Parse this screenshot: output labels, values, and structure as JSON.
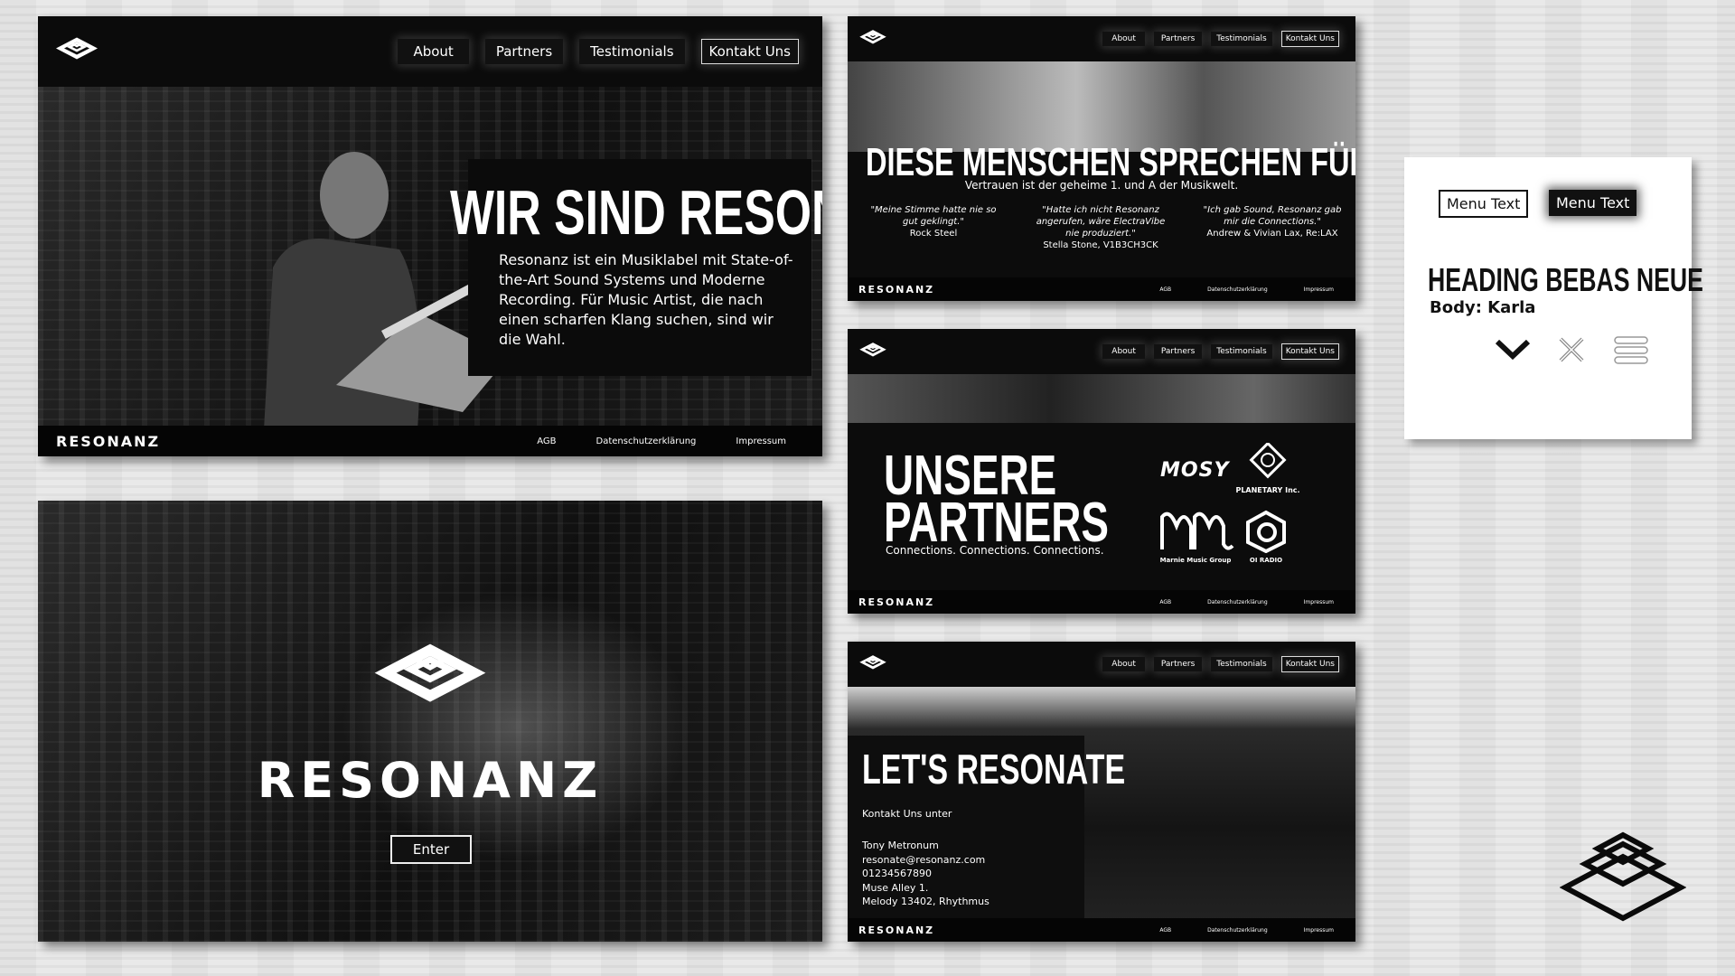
{
  "nav": {
    "about": "About",
    "partners": "Partners",
    "testimonials": "Testimonials",
    "contact": "Kontakt Uns"
  },
  "footer": {
    "brand": "RESONANZ",
    "agb": "AGB",
    "privacy": "Datenschutzerklärung",
    "imprint": "Impressum"
  },
  "home": {
    "heading": "WIR SIND RESONANZ",
    "body": "Resonanz ist ein Musiklabel mit State-of-the-Art Sound Systems und Moderne Recording. Für Music Artist, die nach einen scharfen Klang suchen, sind wir die Wahl."
  },
  "landing": {
    "brand": "RESONANZ",
    "enter": "Enter"
  },
  "testimonials": {
    "heading": "DIESE MENSCHEN SPRECHEN FÜR UNS",
    "subheading": "Vertrauen ist der geheime 1. und A der Musikwelt.",
    "items": [
      {
        "quote": "\"Meine Stimme hatte nie so gut geklingt.\"",
        "author": "Rock Steel"
      },
      {
        "quote": "\"Hatte ich nicht Resonanz angerufen, wäre ElectraVibe nie produziert.\"",
        "author": "Stella Stone, V1B3CH3CK"
      },
      {
        "quote": "\"Ich gab Sound, Resonanz gab mir die Connections.\"",
        "author": "Andrew & Vivian Lax, Re:LAX"
      }
    ]
  },
  "partners": {
    "heading_line1": "UNSERE",
    "heading_line2": "PARTNERS",
    "tagline": "Connections. Connections. Connections.",
    "logos": [
      {
        "name": "MOSY",
        "label": ""
      },
      {
        "name": "planetary",
        "label": "PLANETARY Inc."
      },
      {
        "name": "MM",
        "label": "Marnie Music Group"
      },
      {
        "name": "oi-radio",
        "label": "OI RADIO"
      }
    ]
  },
  "contact": {
    "heading": "LET'S RESONATE",
    "intro": "Kontakt Uns unter",
    "lines": [
      "Tony Metronum",
      "resonate@resonanz.com",
      "01234567890",
      "Muse Alley 1.",
      "Melody 13402, Rhythmus"
    ]
  },
  "styleguide": {
    "menu_text_outline": "Menu Text",
    "menu_text_filled": "Menu Text",
    "heading_sample": "HEADING BEBAS NEUE",
    "body_sample": "Body: Karla",
    "icons": [
      "chevron-down-icon",
      "close-icon",
      "hamburger-menu-icon"
    ]
  }
}
